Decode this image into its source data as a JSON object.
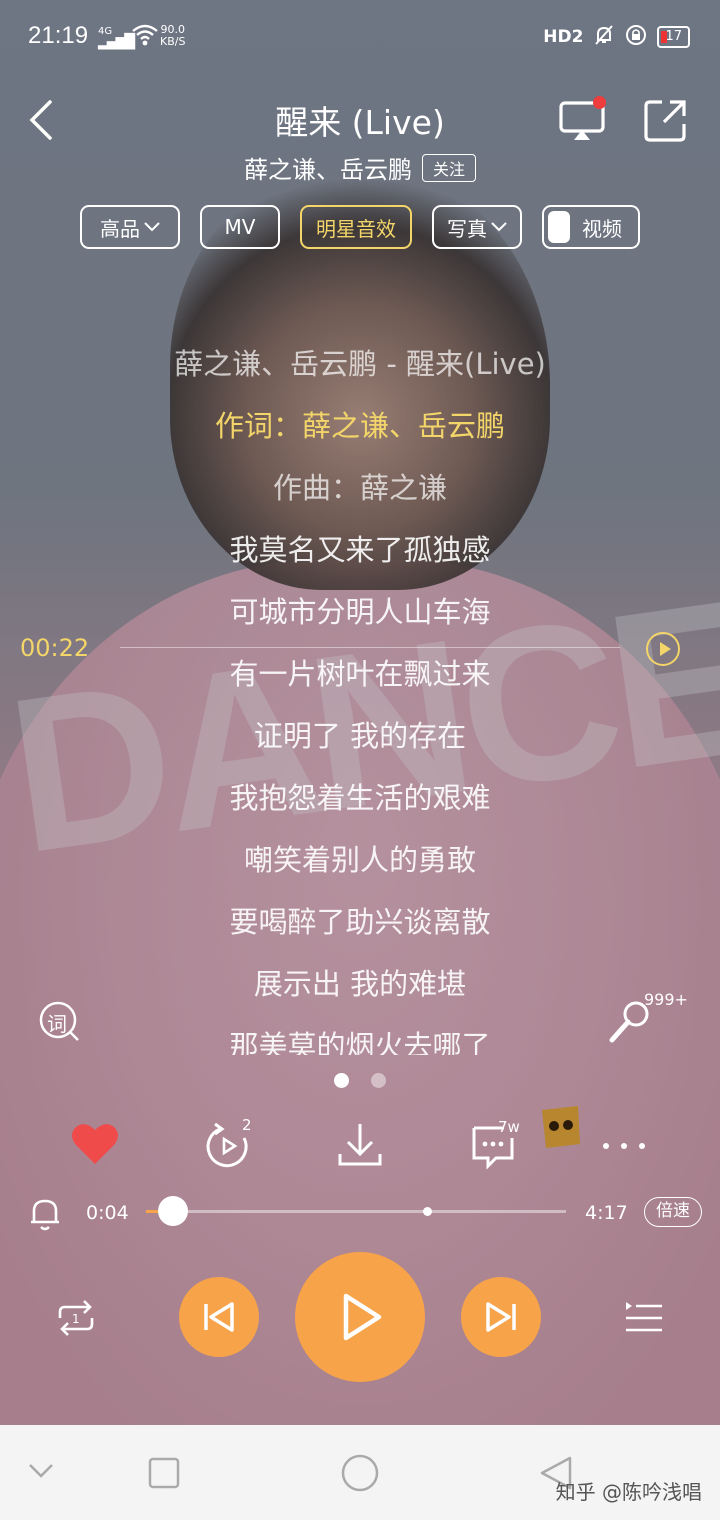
{
  "status_bar": {
    "time": "21:19",
    "network": "4G",
    "speed_value": "90.0",
    "speed_unit": "KB/S",
    "hd_label": "HD2",
    "battery": "17"
  },
  "header": {
    "title": "醒来 (Live)",
    "artists": "薛之谦、岳云鹏",
    "follow_label": "关注"
  },
  "chips": {
    "quality": "高品",
    "mv": "MV",
    "star_effect": "明星音效",
    "photo": "写真",
    "video": "视频"
  },
  "lyrics": [
    {
      "text": "薛之谦、岳云鹏 - 醒来(Live)",
      "kind": "info"
    },
    {
      "text": "作词：薛之谦、岳云鹏",
      "kind": "active"
    },
    {
      "text": "作曲：薛之谦",
      "kind": "info"
    },
    {
      "text": "我莫名又来了孤独感",
      "kind": "normal"
    },
    {
      "text": "可城市分明人山车海",
      "kind": "normal"
    },
    {
      "text": "有一片树叶在飘过来",
      "kind": "normal"
    },
    {
      "text": "证明了 我的存在",
      "kind": "normal"
    },
    {
      "text": "我抱怨着生活的艰难",
      "kind": "normal"
    },
    {
      "text": "嘲笑着别人的勇敢",
      "kind": "normal"
    },
    {
      "text": "要喝醉了助兴谈离散",
      "kind": "normal"
    },
    {
      "text": "展示出 我的难堪",
      "kind": "normal"
    },
    {
      "text": "那美莫的烟火去哪了",
      "kind": "normal"
    }
  ],
  "lyric_seek": {
    "time": "00:22"
  },
  "lyric_tools": {
    "lyric_icon_char": "词",
    "mic_count": "999+"
  },
  "pager": {
    "count": 2,
    "active": 0
  },
  "actions": {
    "replay_badge": "2",
    "comment_badge": "7w"
  },
  "progress": {
    "current": "0:04",
    "duration": "4:17",
    "played_fraction": 0.016,
    "buffered_fraction": 0.66,
    "speed_label": "倍速"
  },
  "footer": {
    "watermark": "知乎 @陈吟浅唱"
  },
  "colors": {
    "accent": "#f6a34a",
    "lyric_highlight": "#f3d56a",
    "like": "#ef4b4b"
  }
}
